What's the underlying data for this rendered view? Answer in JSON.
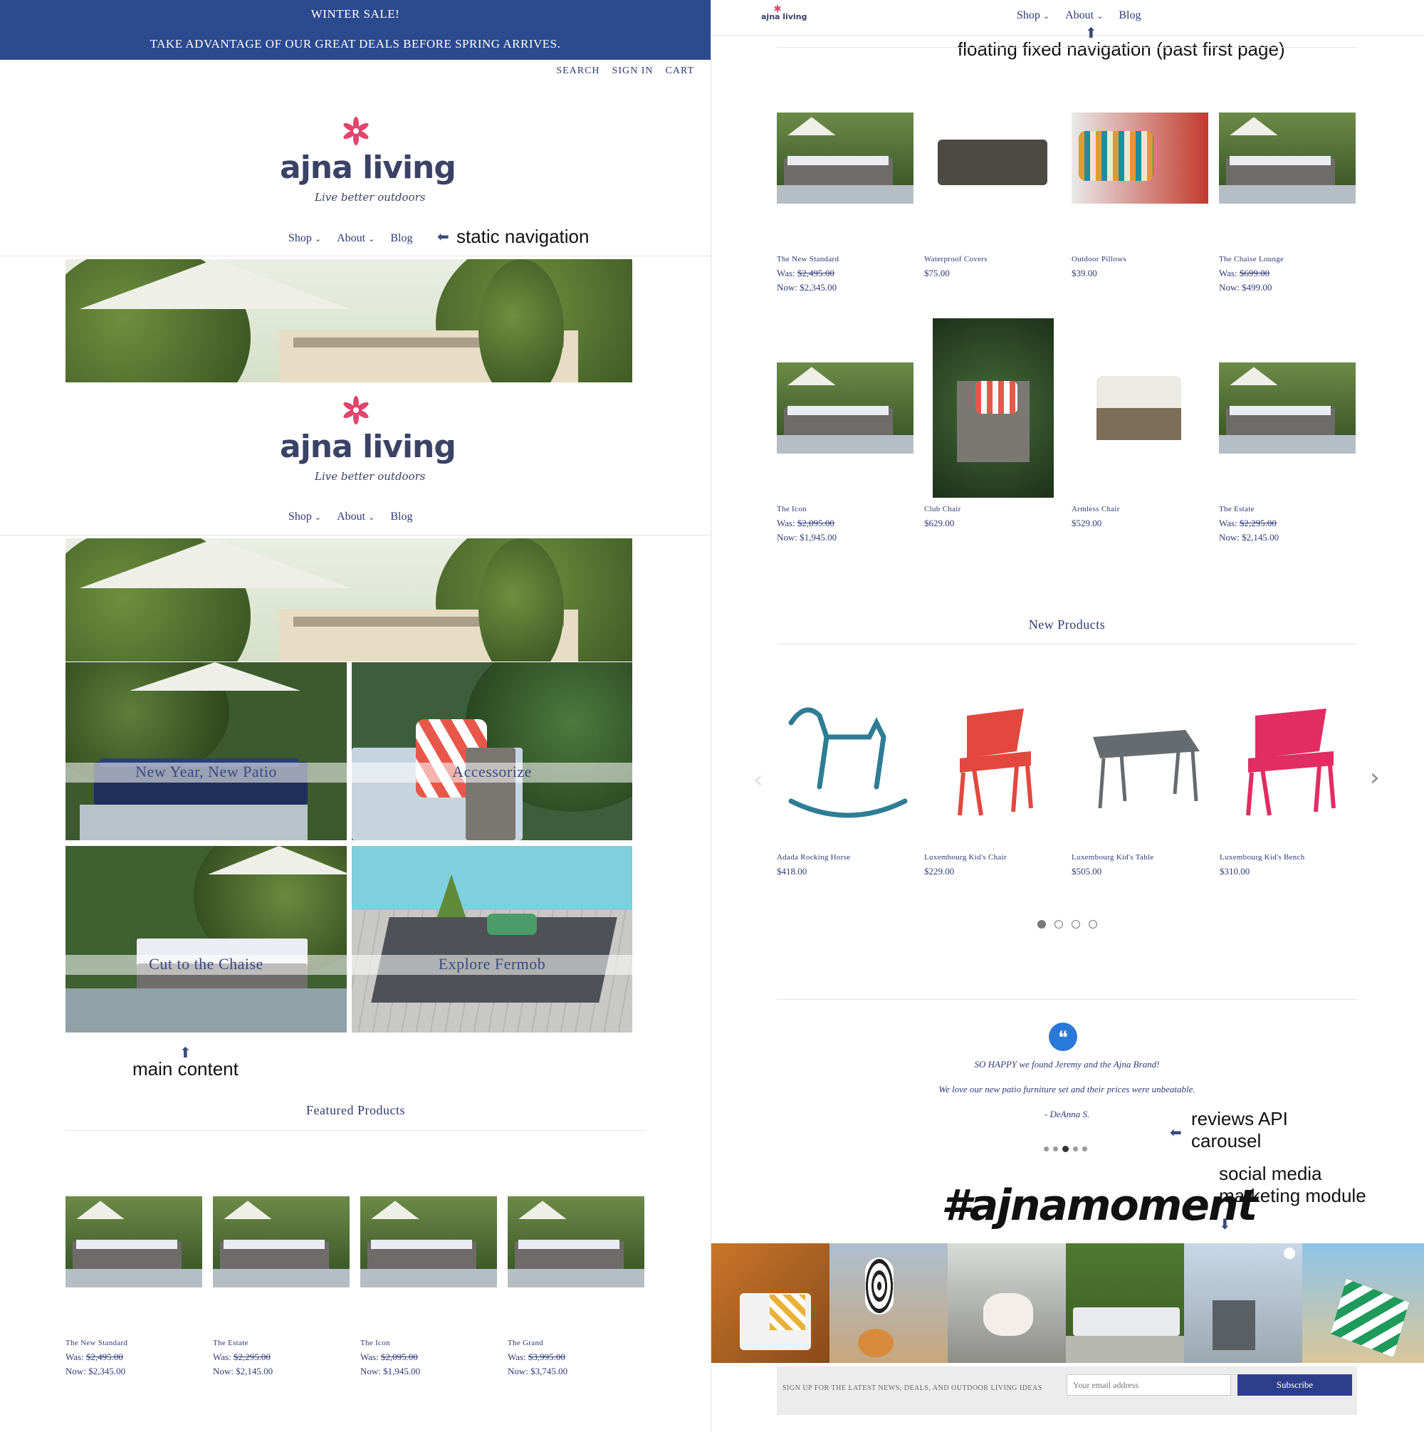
{
  "promo": {
    "line1": "WINTER SALE!",
    "line2": "TAKE ADVANTAGE OF OUR GREAT DEALS BEFORE  SPRING ARRIVES."
  },
  "utility": [
    "SEARCH",
    "SIGN IN",
    "CART"
  ],
  "brand": {
    "name": "ajna living",
    "tagline": "Live better outdoors",
    "accent": "#e2456b"
  },
  "nav": {
    "shop": "Shop",
    "about": "About",
    "blog": "Blog",
    "chevron": "⌄"
  },
  "tiles": [
    {
      "label": "New Year, New Patio"
    },
    {
      "label": "Accessorize"
    },
    {
      "label": "Cut to the Chaise"
    },
    {
      "label": "Explore Fermob"
    }
  ],
  "annotations": {
    "static_nav": "static navigation",
    "main_content": "main content",
    "floating_nav": "floating fixed navigation (past first page)",
    "reviews_1": "reviews API",
    "reviews_2": "carousel",
    "social_1": "social media",
    "social_2": "marketing module"
  },
  "featured": {
    "title": "Featured Products",
    "items": [
      {
        "name": "The New Standard",
        "was_label": "Was:",
        "was": "$2,495.00",
        "now_label": "Now:",
        "now": "$2,345.00"
      },
      {
        "name": "The Estate",
        "was_label": "Was:",
        "was": "$2,295.00",
        "now_label": "Now:",
        "now": "$2,145.00"
      },
      {
        "name": "The Icon",
        "was_label": "Was:",
        "was": "$2,095.00",
        "now_label": "Now:",
        "now": "$1,945.00"
      },
      {
        "name": "The Grand",
        "was_label": "Was:",
        "was": "$3,995.00",
        "now_label": "Now:",
        "now": "$3,745.00"
      }
    ]
  },
  "grid_row1": [
    {
      "name": "The New Standard",
      "was_label": "Was:",
      "was": "$2,495.00",
      "now_label": "Now:",
      "now": "$2,345.00"
    },
    {
      "name": "Waterproof Covers",
      "price": "$75.00"
    },
    {
      "name": "Outdoor Pillows",
      "price": "$39.00"
    },
    {
      "name": "The Chaise Lounge",
      "was_label": "Was:",
      "was": "$699.00",
      "now_label": "Now:",
      "now": "$499.00"
    }
  ],
  "grid_row2": [
    {
      "name": "The Icon",
      "was_label": "Was:",
      "was": "$2,095.00",
      "now_label": "Now:",
      "now": "$1,945.00"
    },
    {
      "name": "Club Chair",
      "price": "$629.00"
    },
    {
      "name": "Armless Chair",
      "price": "$529.00"
    },
    {
      "name": "The Estate",
      "was_label": "Was:",
      "was": "$2,295.00",
      "now_label": "Now:",
      "now": "$2,145.00"
    }
  ],
  "new_products": {
    "title": "New Products",
    "items": [
      {
        "name": "Adada Rocking Horse",
        "price": "$418.00",
        "color": "#2e7d95"
      },
      {
        "name": "Luxembourg Kid's Chair",
        "price": "$229.00",
        "color": "#e2483f"
      },
      {
        "name": "Luxembourg Kid's Table",
        "price": "$505.00",
        "color": "#666b70"
      },
      {
        "name": "Luxembourg Kid's Bench",
        "price": "$310.00",
        "color": "#e12d62"
      }
    ],
    "prev": "‹",
    "next": "›"
  },
  "review": {
    "quote_icon": "❝",
    "line1": "SO HAPPY we found Jeremy and the Ajna Brand!",
    "line2": "We love our new patio furniture set and their prices were unbeatable.",
    "author": "- DeAnna S."
  },
  "social": {
    "hashtag": "#ajnamoment"
  },
  "signup": {
    "label": "SIGN UP FOR THE LATEST NEWS, DEALS, AND OUTDOOR LIVING IDEAS",
    "placeholder": "Your email address",
    "button": "Subscribe"
  }
}
